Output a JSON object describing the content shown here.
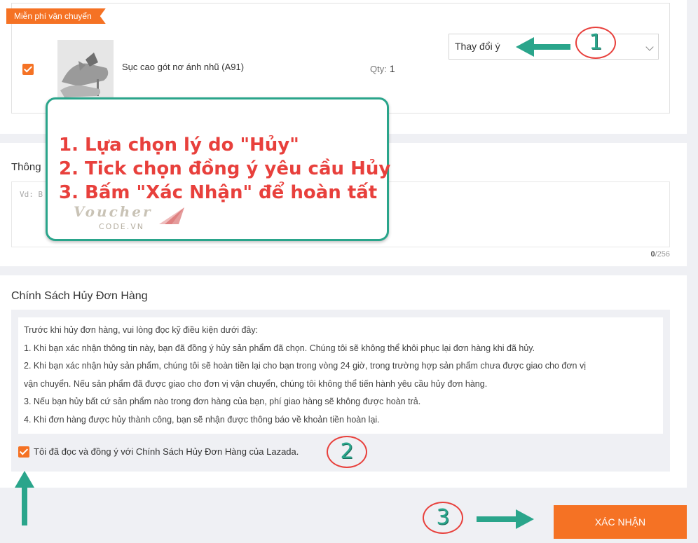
{
  "item": {
    "ribbon": "Miễn phí vận chuyển",
    "product_name": "Sục cao gót nơ ánh nhũ (A91)",
    "qty_label": "Qty:",
    "qty_value": "1",
    "reason_select": "Thay đổi ý"
  },
  "info": {
    "label": "Thông",
    "placeholder": "Vd: B",
    "counter_current": "0",
    "counter_max": "/256"
  },
  "policy": {
    "title": "Chính Sách Hủy Đơn Hàng",
    "lines": [
      "Trước khi hủy đơn hàng, vui lòng đọc kỹ điều kiện dưới đây:",
      "1. Khi bạn xác nhận thông tin này, bạn đã đồng ý hủy sản phẩm đã chọn. Chúng tôi sẽ không thể khôi phục lại đơn hàng khi đã hủy.",
      "2. Khi bạn xác nhận hủy sản phẩm, chúng tôi sẽ hoàn tiền lại cho bạn trong vòng 24 giờ, trong trường hợp sản phẩm chưa được giao cho đơn vị",
      "vận chuyển. Nếu sản phẩm đã được giao cho đơn vị vận chuyển, chúng tôi không thể tiến hành yêu cầu hủy đơn hàng.",
      "3. Nếu bạn hủy bất cứ sản phẩm nào trong đơn hàng của bạn, phí giao hàng sẽ không được hoàn trả.",
      "4. Khi đơn hàng được hủy thành công, bạn sẽ nhận được thông báo về khoản tiền hoàn lại."
    ],
    "agree_label": "Tôi đã đọc và đồng ý với Chính Sách Hủy Đơn Hàng của Lazada."
  },
  "confirm_button": "XÁC NHẬN",
  "annotation": {
    "steps": [
      "1. Lựa chọn lý do \"Hủy\"",
      "2. Tick chọn đồng ý yêu cầu Hủy",
      "3. Bấm \"Xác Nhận\" để hoàn tất"
    ],
    "badges": [
      "1",
      "2",
      "3"
    ],
    "watermark": "Voucher",
    "watermark_sub": "CODE.VN"
  },
  "colors": {
    "accent": "#f57224",
    "annotation_green": "#2aa58b",
    "annotation_red": "#e8403c"
  }
}
